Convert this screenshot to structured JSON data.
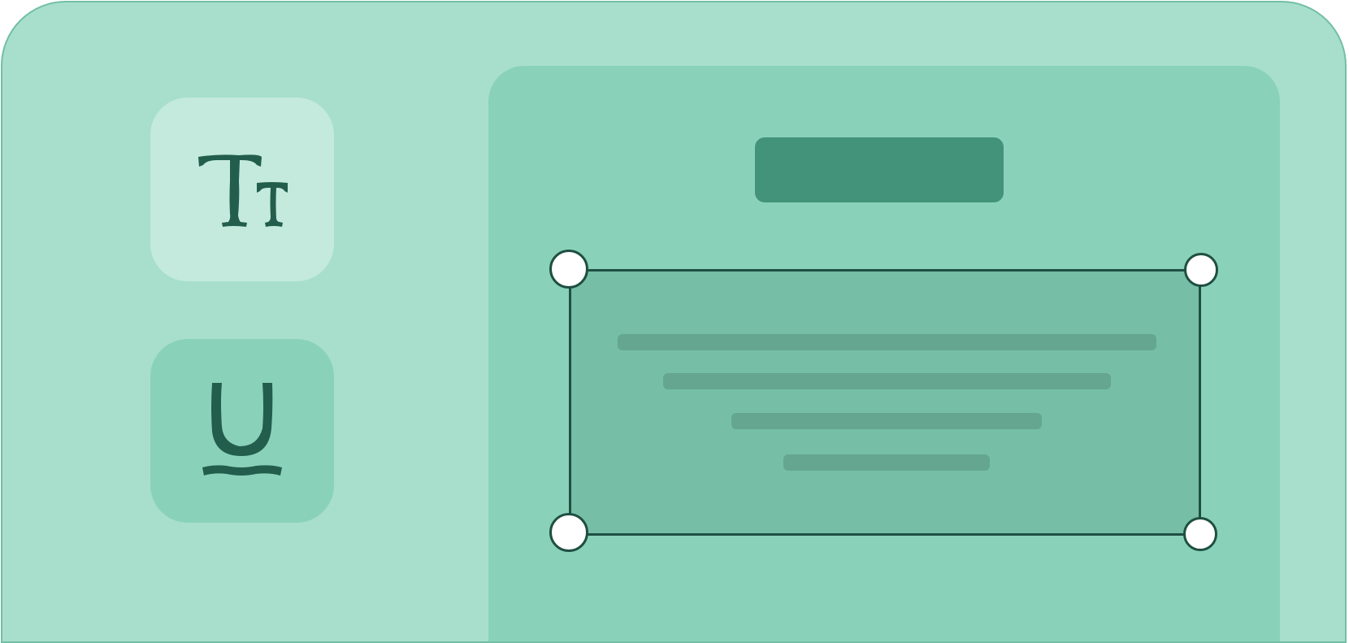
{
  "colors": {
    "window_bg": "#a8dfcc",
    "window_border": "#73bfa6",
    "panel_bg": "#89d2b9",
    "tool_active_bg": "#c3eadd",
    "tool_bg": "#89d2b9",
    "icon_color": "#235e4d",
    "header_block": "#42937a",
    "selection_fill": "#76bea6",
    "selection_stroke": "#1f4f42",
    "text_line": "#64a68f",
    "handle_fill": "#ffffff"
  },
  "toolbar": {
    "tools": [
      {
        "icon": "text-size-icon",
        "state": "selected"
      },
      {
        "icon": "underline-icon",
        "state": "default"
      }
    ]
  },
  "canvas": {
    "header_placeholder": {
      "kind": "block"
    },
    "selected_text_box": {
      "text_lines": 4,
      "handles": [
        "top-left",
        "top-right",
        "bottom-left",
        "bottom-right"
      ]
    }
  }
}
